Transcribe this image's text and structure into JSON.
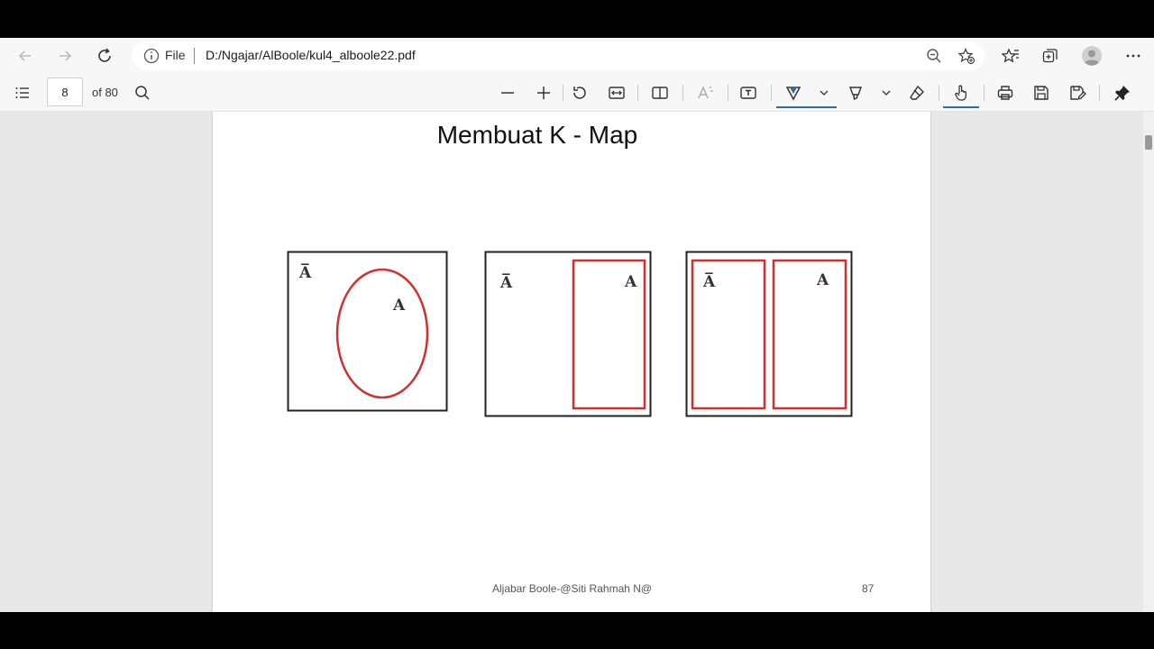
{
  "browser": {
    "file_label": "File",
    "url": "D:/Ngajar/AlBoole/kul4_alboole22.pdf"
  },
  "pdf_toolbar": {
    "page_value": "8",
    "page_total": "of 80"
  },
  "slide": {
    "title": "Membuat K - Map",
    "footer": "Aljabar Boole-@Siti Rahmah N@",
    "page_number": "87",
    "diagrams": [
      {
        "type": "venn",
        "labels": [
          "A̅",
          "A"
        ]
      },
      {
        "type": "box-half",
        "labels": [
          "A̅",
          "A"
        ]
      },
      {
        "type": "two-cells",
        "labels": [
          "A̅",
          "A"
        ]
      }
    ]
  },
  "colors": {
    "accent": "#2b6cb0",
    "region": "#d32f2f",
    "outline": "#222222"
  },
  "icons": [
    "back-arrow-icon",
    "forward-arrow-icon",
    "refresh-icon",
    "info-icon",
    "zoom-out-icon",
    "favorite-add-icon",
    "favorites-icon",
    "collections-icon",
    "profile-icon",
    "more-icon",
    "contents-icon",
    "search-icon",
    "minus-icon",
    "plus-icon",
    "rotate-icon",
    "fit-width-icon",
    "page-view-icon",
    "read-aloud-icon",
    "text-box-icon",
    "draw-icon",
    "chevron-down-icon",
    "highlight-icon",
    "eraser-icon",
    "touch-icon",
    "print-icon",
    "save-icon",
    "save-as-icon",
    "pin-icon"
  ]
}
